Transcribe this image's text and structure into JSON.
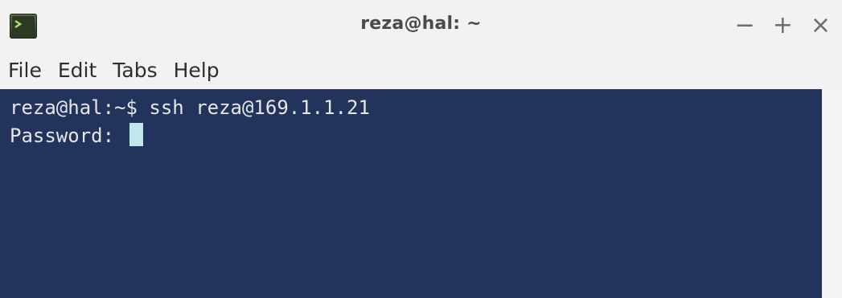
{
  "window": {
    "title": "reza@hal: ~",
    "controls": {
      "minimize": "−",
      "maximize": "+",
      "close": "×"
    }
  },
  "menu": {
    "items": [
      "File",
      "Edit",
      "Tabs",
      "Help"
    ]
  },
  "terminal": {
    "lines": [
      "reza@hal:~$ ssh reza@169.1.1.21",
      "Password: "
    ],
    "background": "#22335c",
    "foreground": "#e6e6e6",
    "cursor_color": "#bfe7ee"
  },
  "icons": {
    "app": "terminal-icon"
  }
}
